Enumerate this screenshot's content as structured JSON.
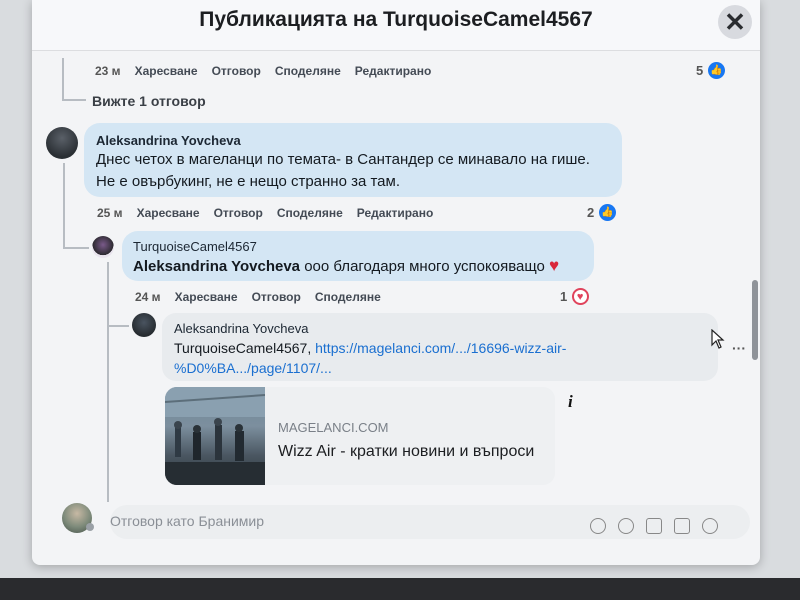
{
  "modal": {
    "title": "Публикацията на TurquoiseCamel4567",
    "close_glyph": "✕"
  },
  "comment_prev": {
    "time": "23 м",
    "like": "Харесване",
    "reply": "Отговор",
    "share": "Споделяне",
    "edited": "Редактирано",
    "reactions": "5"
  },
  "see_replies": "Вижте 1 отговор",
  "comment_main": {
    "author": "Aleksandrina Yovcheva",
    "line1": "Днес четох в магеланци по темата- в Сантандер се минавало на гише.",
    "line2": "Не е овърбукинг, не е нещо странно за там.",
    "time": "25 м",
    "like": "Харесване",
    "reply": "Отговор",
    "share": "Споделяне",
    "edited": "Редактирано",
    "reactions": "2"
  },
  "reply_1": {
    "author": "TurquoiseCamel4567",
    "mention": "Aleksandrina Yovcheva",
    "text": " ооо благодаря много успокояващо",
    "time": "24 м",
    "like": "Харесване",
    "reply": "Отговор",
    "share": "Споделяне",
    "reactions": "1"
  },
  "reply_2": {
    "author": "Aleksandrina Yovcheva",
    "prefix": "TurquoiseCamel4567, ",
    "link1": "https://magelanci.com/.../16696-wizz-air-",
    "link2": "%D0%BA.../page/1107/...",
    "more": "···"
  },
  "link_preview": {
    "domain": "MAGELANCI.COM",
    "title": "Wizz Air - кратки новини и въпроси",
    "info_glyph": "i"
  },
  "reply_input": {
    "placeholder": "Отговор като Бранимир"
  },
  "icons": {
    "like_glyph": "👍",
    "heart_glyph": "♥"
  },
  "colors": {
    "accent": "#1877f2",
    "bubble": "#d4e6f4",
    "heart": "#e0435c",
    "link": "#1a6fd0"
  }
}
